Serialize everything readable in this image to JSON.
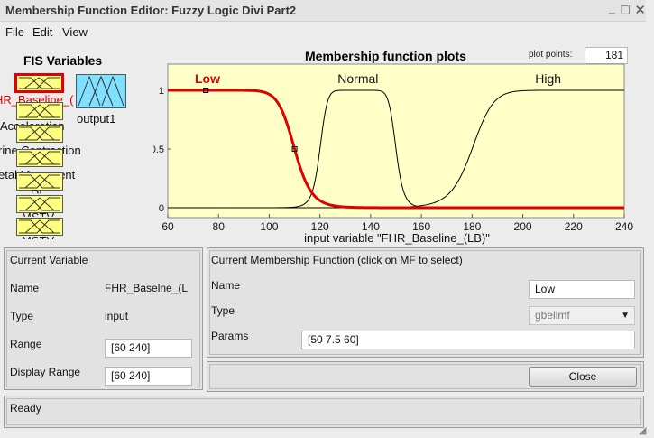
{
  "window": {
    "title": "Membership Function Editor: Fuzzy Logic Divi Part2",
    "close_glyph": "✕",
    "max_glyph": "□",
    "min_glyph": "_"
  },
  "menu": {
    "items": [
      "File",
      "Edit",
      "View"
    ]
  },
  "fis": {
    "title": "FIS Variables",
    "inputs": [
      "FHR_Baseline_(LB)",
      "Acceleration",
      "Uterine Contraction",
      "Fetal Movement",
      "DL",
      "MSTV",
      "MSTV"
    ],
    "visible_labels": [
      "HR_Baseline_(",
      "Acceleration",
      "rine Contraction",
      "etal Movement",
      "DL",
      "MSTV",
      "MSTV"
    ],
    "output_label": "output1"
  },
  "plot": {
    "title": "Membership function plots",
    "points_label": "plot points:",
    "points_value": "181",
    "bg_color": "#ffffc8",
    "selected_color": "#e00000"
  },
  "chart_data": {
    "type": "line",
    "xlabel": "input variable \"FHR_Baseline_(LB)\"",
    "xlim": [
      60,
      240
    ],
    "ylim": [
      0,
      1
    ],
    "x_ticks": [
      60,
      80,
      100,
      120,
      140,
      160,
      180,
      200,
      220,
      240
    ],
    "y_ticks": [
      0,
      0.5,
      1
    ],
    "series": [
      {
        "name": "Low",
        "mf_type": "gbellmf",
        "params": [
          50,
          7.5,
          60
        ],
        "selected": true
      },
      {
        "name": "Normal",
        "mf_type": "gbellmf",
        "params": [
          15,
          5,
          135
        ],
        "selected": false
      },
      {
        "name": "High",
        "mf_type": "gbellmf",
        "params": [
          60,
          7,
          240
        ],
        "selected": false
      }
    ]
  },
  "current_variable": {
    "title": "Current Variable",
    "name_label": "Name",
    "name_value": "FHR_Baselne_(L",
    "type_label": "Type",
    "type_value": "input",
    "range_label": "Range",
    "range_value": "[60 240]",
    "display_range_label": "Display Range",
    "display_range_value": "[60 240]"
  },
  "current_mf": {
    "title": "Current Membership Function (click on MF to select)",
    "name_label": "Name",
    "name_value": "Low",
    "type_label": "Type",
    "type_value": "gbellmf",
    "params_label": "Params",
    "params_value": "[50 7.5 60]"
  },
  "buttons": {
    "close": "Close"
  },
  "status": {
    "text": "Ready"
  }
}
